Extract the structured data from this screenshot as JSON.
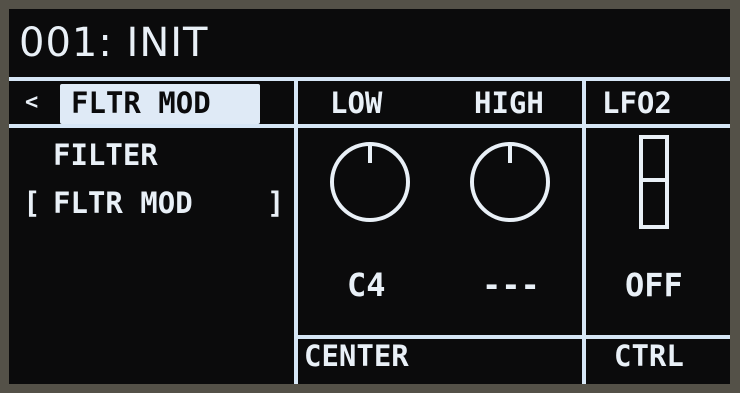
{
  "display": {
    "preset_title": "001: INIT",
    "page_arrow": "<",
    "page_name": "FLTR MOD",
    "left_panel": {
      "param_label": "FILTER",
      "bracket_open": "[",
      "param_value": "FLTR MOD",
      "bracket_close": "]"
    },
    "columns": [
      {
        "header": "LOW",
        "value": "C4",
        "control": "knob"
      },
      {
        "header": "HIGH",
        "value": "---",
        "control": "knob"
      },
      {
        "header": "LFO2",
        "value": "OFF",
        "control": "slider"
      }
    ],
    "footer": {
      "group_label": "CENTER",
      "ctrl_label": "CTRL"
    },
    "colors": {
      "bezel": "#545148",
      "screen_bg": "#0b0b0c",
      "foreground": "#e9f0f7",
      "highlight": "#dfeaf6"
    }
  }
}
